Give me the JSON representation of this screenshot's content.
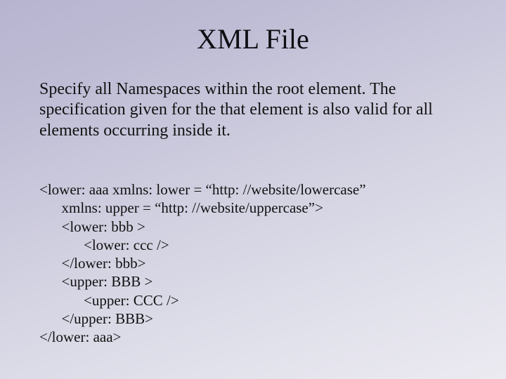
{
  "title": "XML File",
  "description": "Specify all Namespaces within the root element. The specification given for the that element is also valid for all elements occurring inside it.",
  "code": {
    "l1": "<lower: aaa xmlns: lower = “http: //website/lowercase”",
    "l2": "      xmlns: upper = “http: //website/uppercase”>",
    "l3": "      <lower: bbb >",
    "l4": "            <lower: ccc />",
    "l5": "      </lower: bbb>",
    "l6": "      <upper: BBB >",
    "l7": "            <upper: CCC />",
    "l8": "      </upper: BBB>",
    "l9": "</lower: aaa>"
  }
}
